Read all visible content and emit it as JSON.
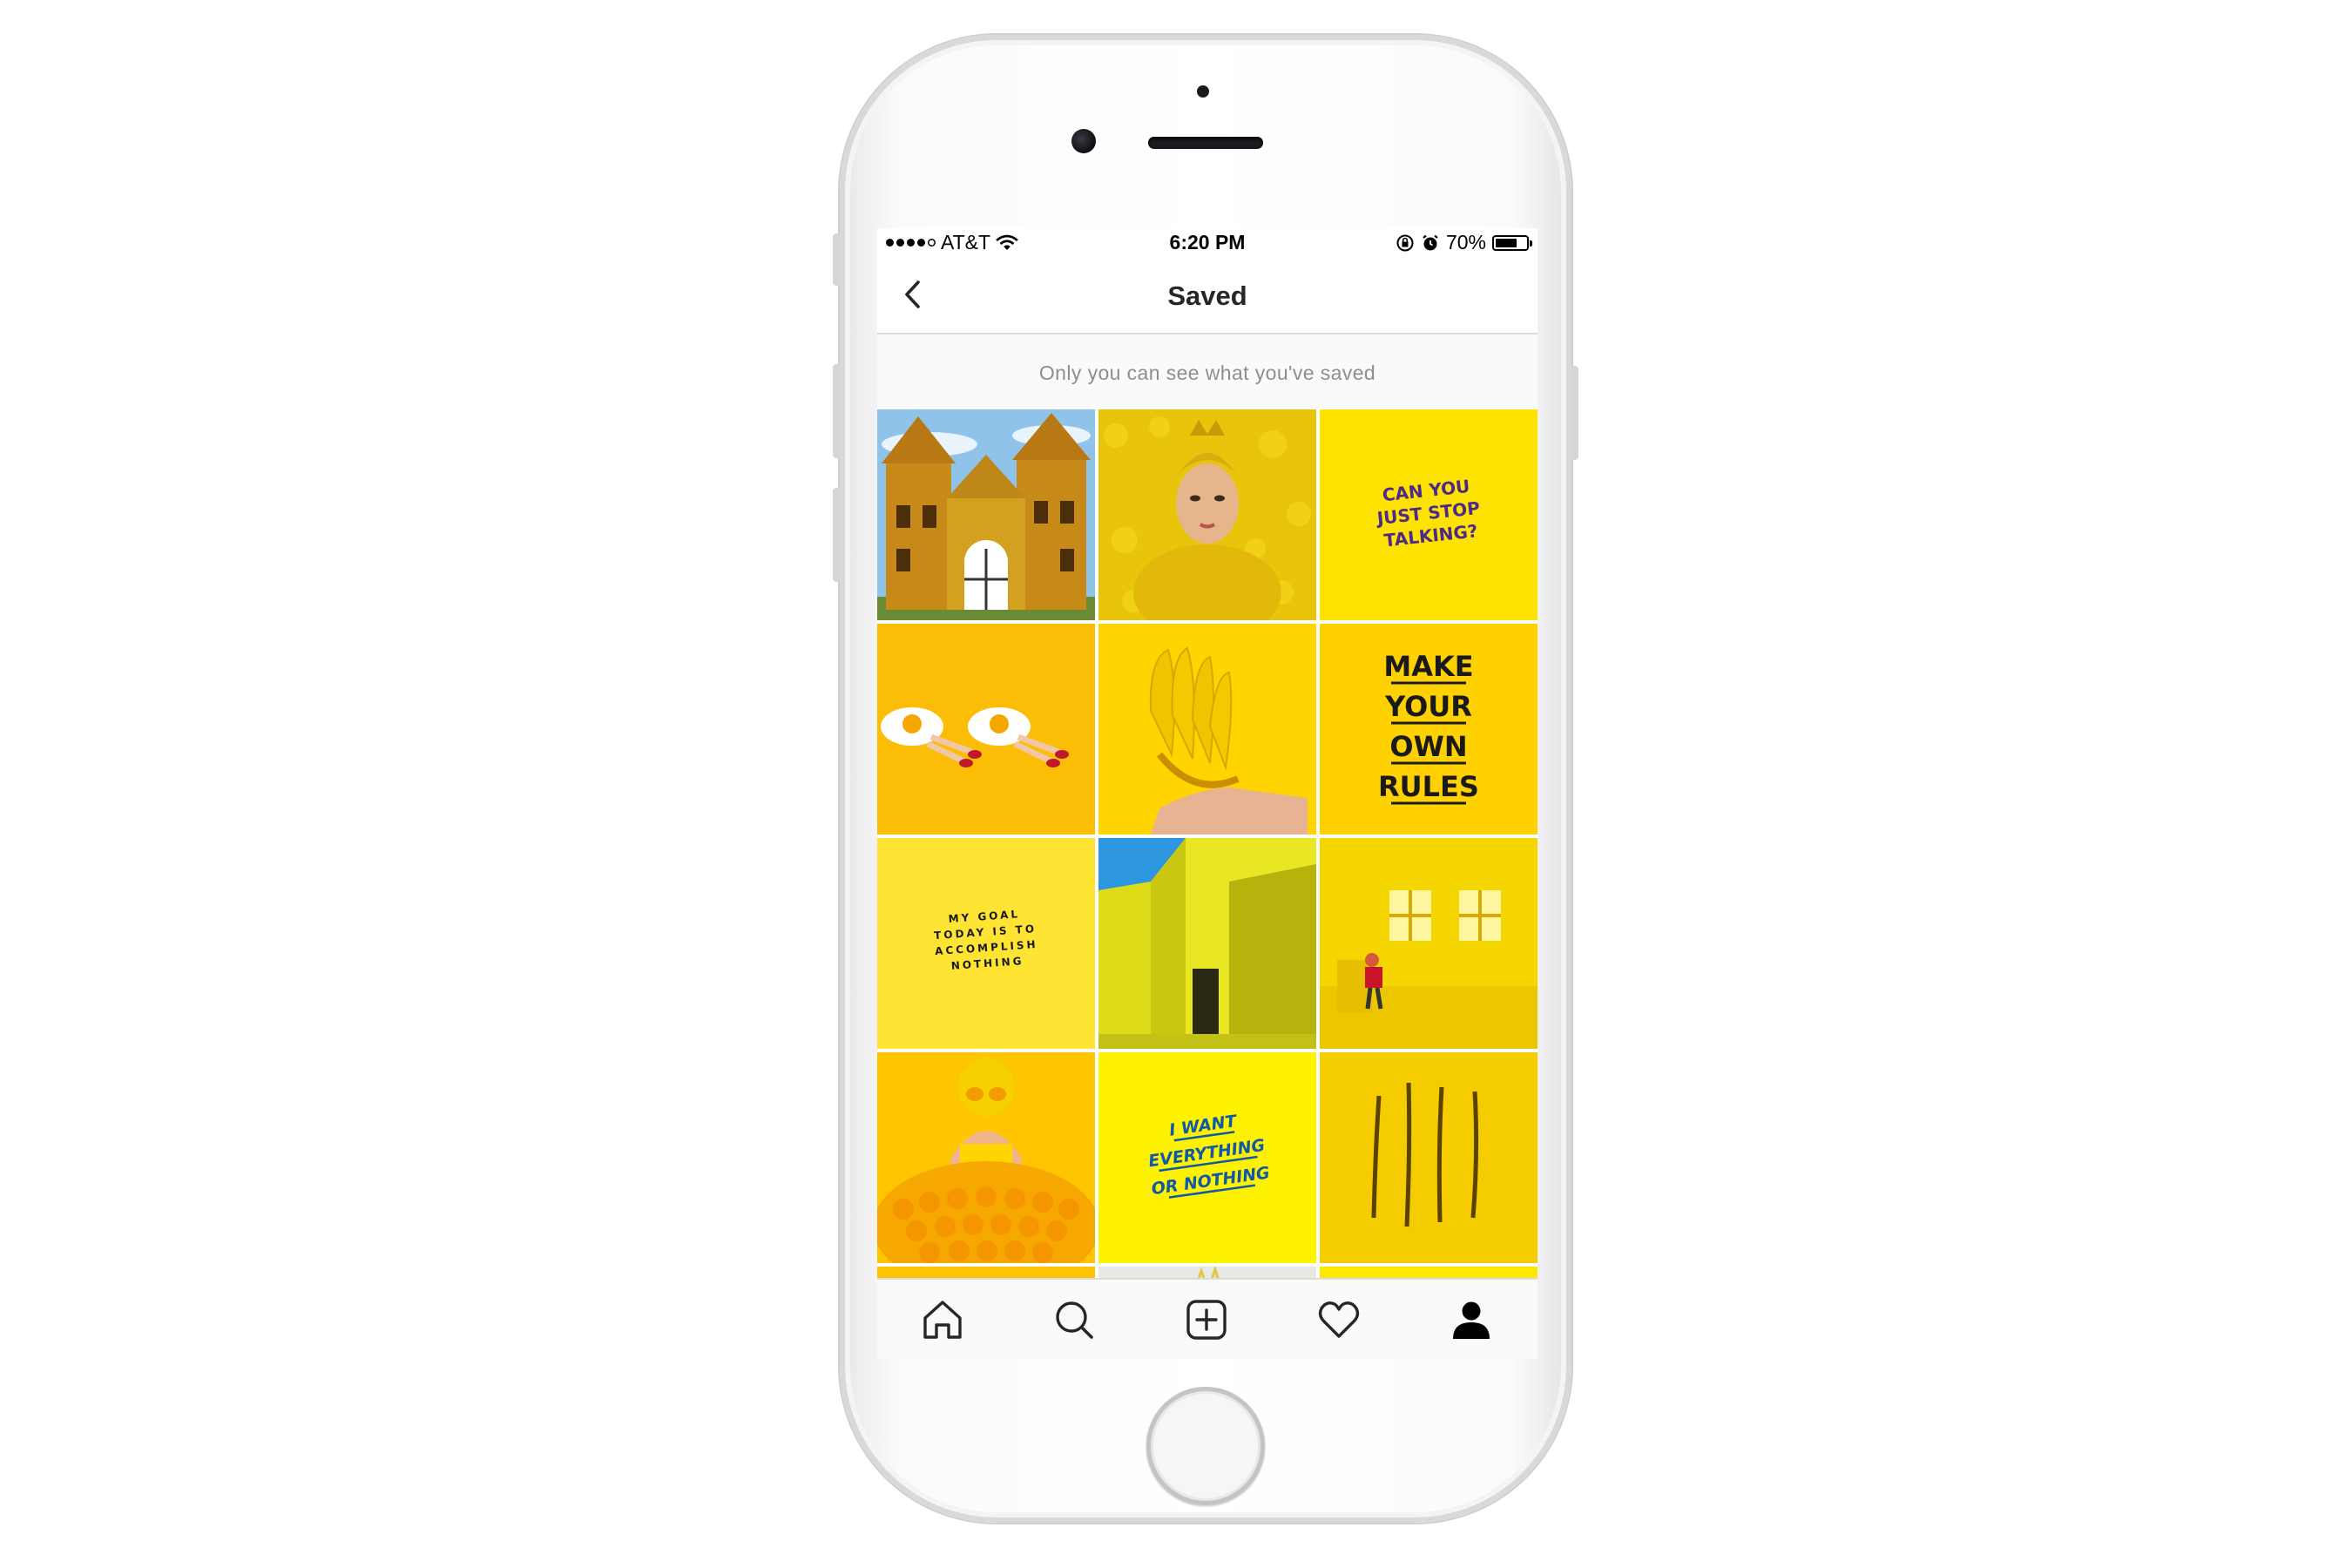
{
  "status_bar": {
    "carrier": "AT&T",
    "time": "6:20 PM",
    "battery_percent": "70%",
    "battery_level": 0.7,
    "signal_bars": 4
  },
  "nav": {
    "title": "Saved",
    "back_icon": "chevron-left-icon"
  },
  "banner": {
    "text": "Only you can see what you've saved"
  },
  "grid": {
    "quote_can_you": [
      "CAN YOU",
      "JUST STOP",
      "TALKING?"
    ],
    "quote_make_rules": [
      "MAKE",
      "YOUR",
      "OWN",
      "RULES"
    ],
    "quote_goal": [
      "MY GOAL",
      "TODAY IS TO",
      "ACCOMPLISH",
      "NOTHING"
    ],
    "quote_want": [
      "I WANT",
      "EVERYTHING",
      "OR NOTHING"
    ]
  },
  "tab_bar": {
    "tabs": [
      "home-icon",
      "search-icon",
      "new-post-icon",
      "heart-icon",
      "profile-icon"
    ]
  },
  "colors": {
    "yellow_bright": "#FFE600",
    "yellow_warm": "#FFC200",
    "purple_text": "#4B2A8A",
    "blue_text": "#0E5AA8"
  }
}
